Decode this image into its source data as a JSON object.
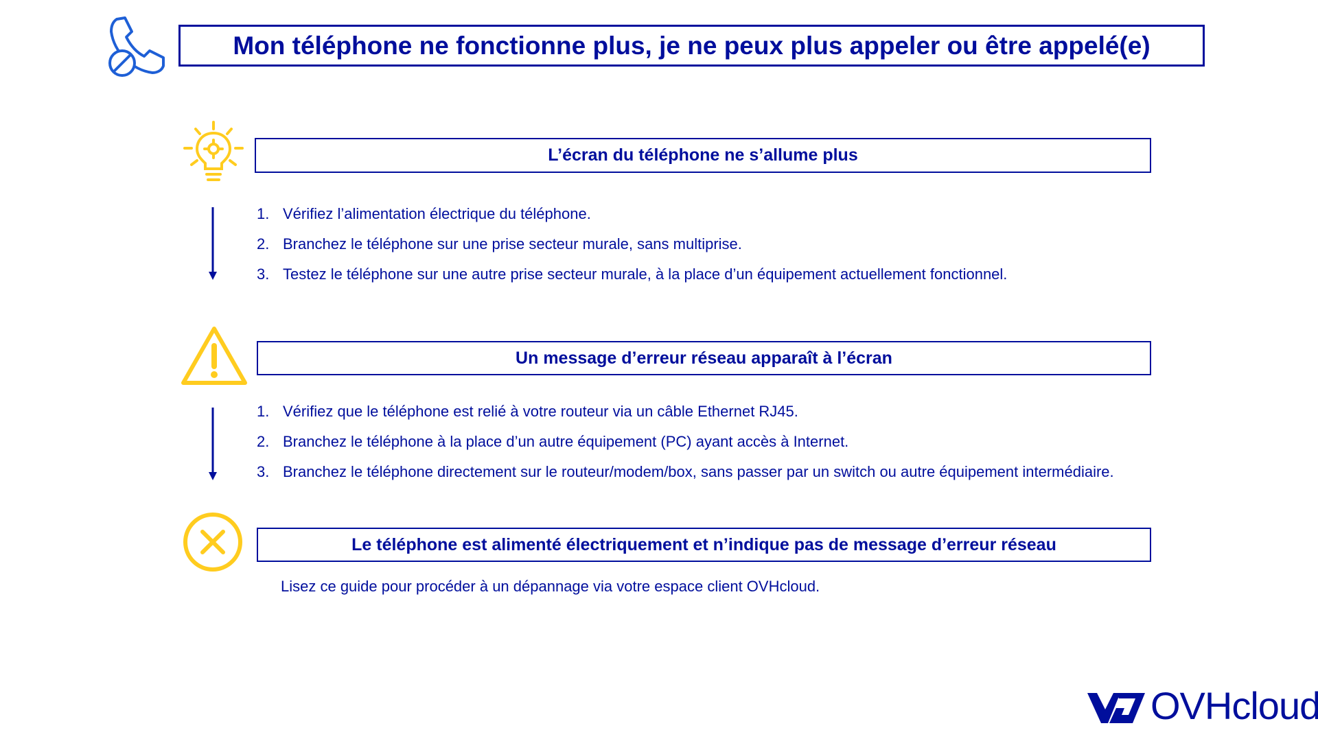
{
  "header": {
    "title": "Mon téléphone ne fonctionne plus, je ne peux plus appeler ou être appelé(e)",
    "icon": "phone-off-icon"
  },
  "sections": [
    {
      "icon": "lightbulb-icon",
      "title": "L’écran du téléphone ne s’allume plus",
      "steps": [
        {
          "num": "1.",
          "text": "Vérifiez l’alimentation électrique du téléphone."
        },
        {
          "num": "2.",
          "text": "Branchez le téléphone sur une prise secteur murale, sans multiprise."
        },
        {
          "num": "3.",
          "text": "Testez le téléphone sur une autre prise secteur murale, à la place d’un équipement actuellement fonctionnel."
        }
      ]
    },
    {
      "icon": "warning-icon",
      "title": "Un message d’erreur réseau apparaît à l’écran",
      "steps": [
        {
          "num": "1.",
          "text": "Vérifiez que le téléphone est relié à votre routeur via un câble Ethernet RJ45."
        },
        {
          "num": "2.",
          "text": "Branchez le téléphone à la place d’un autre équipement (PC) ayant accès à Internet."
        },
        {
          "num": "3.",
          "text": "Branchez le téléphone directement sur le routeur/modem/box, sans passer par un switch ou autre équipement intermédiaire."
        }
      ]
    },
    {
      "icon": "close-circle-icon",
      "title": "Le téléphone est alimenté électriquement et n’indique pas de message d’erreur réseau",
      "note": "Lisez ce guide pour procéder à un dépannage via votre espace client OVHcloud."
    }
  ],
  "logo": {
    "text": "OVHcloud"
  },
  "colors": {
    "primary": "#000e9c",
    "accent": "#ffcc1f",
    "icon_blue": "#1e5fd6"
  }
}
